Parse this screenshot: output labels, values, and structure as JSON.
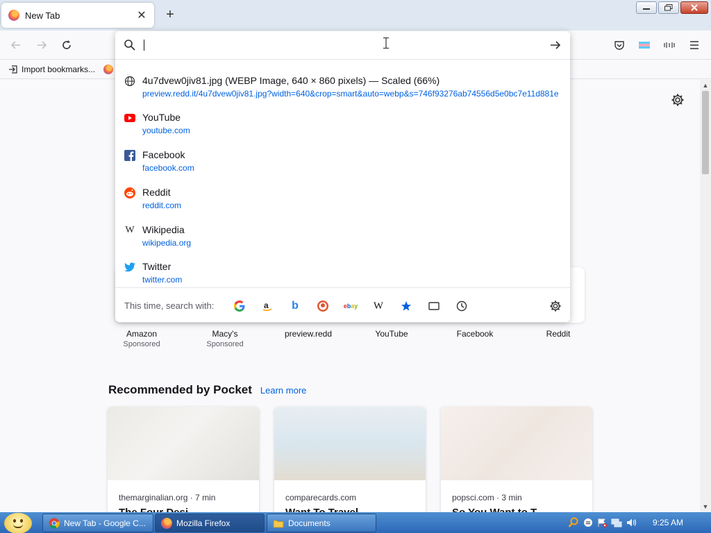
{
  "browser": {
    "tab": {
      "title": "New Tab"
    },
    "new_tab_symbol": "+",
    "bookmarks_bar": {
      "import_label": "Import bookmarks..."
    }
  },
  "urlbar": {
    "value": "",
    "suggestions": [
      {
        "title": "4u7dvew0jiv81.jpg (WEBP Image, 640 × 860 pixels) — Scaled (66%)",
        "url": "preview.redd.it/4u7dvew0jiv81.jpg?width=640&crop=smart&auto=webp&s=746f93276ab74556d5e0bc7e11d881e6",
        "icon": "globe-icon"
      },
      {
        "title": "YouTube",
        "url": "youtube.com",
        "icon": "youtube-icon"
      },
      {
        "title": "Facebook",
        "url": "facebook.com",
        "icon": "facebook-icon"
      },
      {
        "title": "Reddit",
        "url": "reddit.com",
        "icon": "reddit-icon"
      },
      {
        "title": "Wikipedia",
        "url": "wikipedia.org",
        "icon": "wikipedia-icon"
      },
      {
        "title": "Twitter",
        "url": "twitter.com",
        "icon": "twitter-icon"
      }
    ],
    "search_with_label": "This time, search with:",
    "engines": [
      "google",
      "amazon",
      "bing",
      "duckduckgo",
      "ebay",
      "wikipedia",
      "bookmarks",
      "tabs",
      "history"
    ]
  },
  "shortcuts": [
    {
      "label": "Amazon",
      "sponsored": "Sponsored"
    },
    {
      "label": "Macy's",
      "sponsored": "Sponsored"
    },
    {
      "label": "preview.redd",
      "sponsored": ""
    },
    {
      "label": "YouTube",
      "sponsored": ""
    },
    {
      "label": "Facebook",
      "sponsored": ""
    },
    {
      "label": "Reddit",
      "sponsored": ""
    }
  ],
  "pocket": {
    "heading": "Recommended by Pocket",
    "learn_more": "Learn more",
    "cards": [
      {
        "source": "themarginalian.org · 7 min",
        "title": "The Four Desi..."
      },
      {
        "source": "comparecards.com",
        "title": "Want To Travel..."
      },
      {
        "source": "popsci.com · 3 min",
        "title": "So You Want to T..."
      }
    ]
  },
  "taskbar": {
    "tasks": [
      {
        "label": "New Tab - Google C..."
      },
      {
        "label": "Mozilla Firefox"
      },
      {
        "label": "Documents"
      }
    ],
    "clock": "9:25 AM"
  },
  "colors": {
    "accent": "#0061e0",
    "taskbar": "#3a76c0"
  }
}
